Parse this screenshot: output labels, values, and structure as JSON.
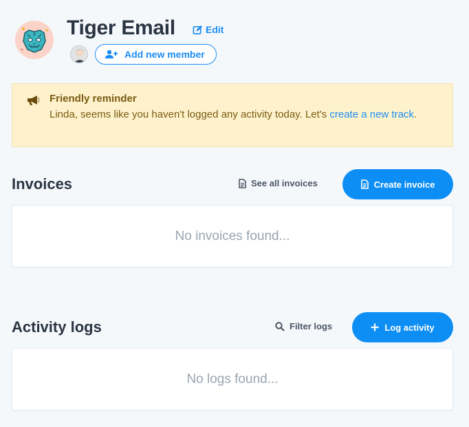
{
  "team": {
    "name": "Tiger Email",
    "edit_label": "Edit",
    "add_member_label": "Add new member"
  },
  "reminder": {
    "title": "Friendly reminder",
    "body_prefix": "Linda, seems like you haven't logged any activity today. Let's ",
    "link_text": "create a new track",
    "body_suffix": "."
  },
  "invoices": {
    "title": "Invoices",
    "see_all_label": "See all invoices",
    "create_label": "Create invoice",
    "empty_text": "No invoices found..."
  },
  "activity": {
    "title": "Activity logs",
    "filter_label": "Filter logs",
    "log_label": "Log activity",
    "empty_text": "No logs found..."
  },
  "colors": {
    "accent": "#0d8ef5",
    "reminder_bg": "#fef2cc",
    "reminder_text": "#7a5a10",
    "empty_text": "#9aa5b1"
  },
  "icons": {
    "team_logo": "tiger-face-icon",
    "edit": "pencil-square-icon",
    "add_member": "user-plus-icon",
    "reminder": "megaphone-icon",
    "see_all": "document-icon",
    "create_invoice": "document-icon",
    "filter": "search-icon",
    "log_activity": "plus-icon"
  }
}
